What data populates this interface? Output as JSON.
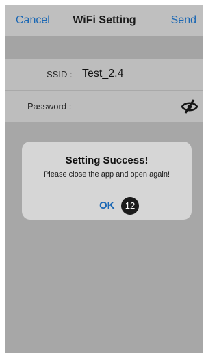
{
  "navbar": {
    "cancel_label": "Cancel",
    "title": "WiFi Setting",
    "send_label": "Send"
  },
  "form": {
    "ssid_label": "SSID :",
    "ssid_value": "Test_2.4",
    "password_label": "Password :",
    "password_value": "",
    "visibility_icon": "eye-slash-icon"
  },
  "dialog": {
    "title": "Setting Success!",
    "message": "Please close the app and open again!",
    "ok_label": "OK",
    "step_badge": "12"
  },
  "colors": {
    "accent": "#1a67b4",
    "navbar_bg": "#bfbfbf",
    "overlay_bg": "#a7a7a7",
    "dialog_bg": "#d6d6d6",
    "badge_bg": "#1b1b1b"
  }
}
